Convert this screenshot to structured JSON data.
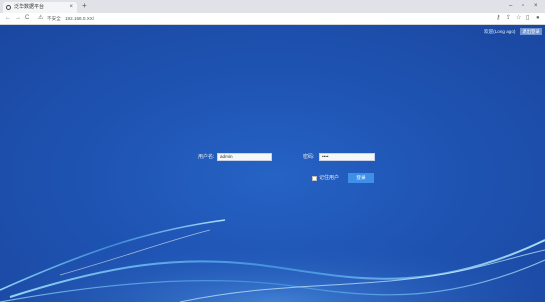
{
  "browser": {
    "tab_title": "泛华数据平台",
    "tab_close": "×",
    "new_tab": "+",
    "window_controls": {
      "minimize": "–",
      "restore": "▫",
      "close": "×"
    },
    "nav": {
      "back": "←",
      "forward": "→",
      "reload": "C"
    },
    "security_label": "不安全",
    "url": "192.168.0.XX/"
  },
  "header": {
    "user_info": "欢迎(Long ago)",
    "logout_label": "退出登录"
  },
  "login": {
    "username_label": "用户名:",
    "username_value": "admin",
    "password_label": "密码:",
    "password_value": "••••",
    "remember_label": "记住用户",
    "submit_label": "登录"
  },
  "colors": {
    "background": "#1f54b4",
    "accent": "#3f8fe8",
    "wave": "#7fd4ff"
  }
}
